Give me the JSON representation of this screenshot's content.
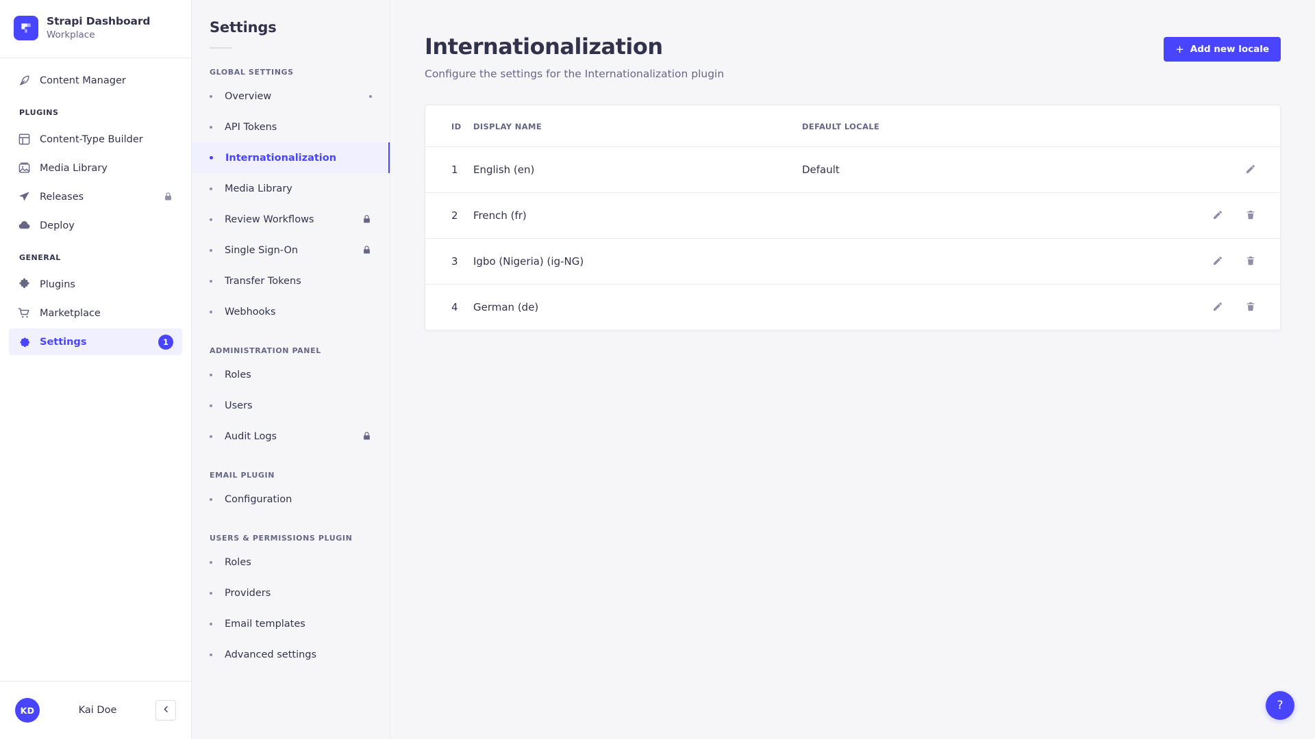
{
  "brand": {
    "title": "Strapi Dashboard",
    "subtitle": "Workplace",
    "logo_icon": "strapi-logo-icon",
    "accent_color": "#4945ff"
  },
  "mainnav": {
    "top_items": [
      {
        "label": "Content Manager",
        "icon": "feather-pen-icon",
        "locked": false,
        "active": false
      }
    ],
    "sections": [
      {
        "label": "PLUGINS",
        "items": [
          {
            "label": "Content-Type Builder",
            "icon": "layout-grid-icon",
            "locked": false,
            "active": false
          },
          {
            "label": "Media Library",
            "icon": "image-icon",
            "locked": false,
            "active": false
          },
          {
            "label": "Releases",
            "icon": "paper-plane-icon",
            "locked": true,
            "active": false
          },
          {
            "label": "Deploy",
            "icon": "cloud-icon",
            "locked": false,
            "active": false
          }
        ]
      },
      {
        "label": "GENERAL",
        "items": [
          {
            "label": "Plugins",
            "icon": "puzzle-piece-icon",
            "locked": false,
            "active": false
          },
          {
            "label": "Marketplace",
            "icon": "shopping-cart-icon",
            "locked": false,
            "active": false
          },
          {
            "label": "Settings",
            "icon": "gear-icon",
            "locked": false,
            "active": true,
            "badge": "1"
          }
        ]
      }
    ]
  },
  "user": {
    "initials": "KD",
    "name": "Kai Doe",
    "collapse_icon": "chevron-left-icon"
  },
  "subnav": {
    "title": "Settings",
    "sections": [
      {
        "label": "GLOBAL SETTINGS",
        "items": [
          {
            "label": "Overview",
            "active": false,
            "locked": false,
            "trailing_dot": true
          },
          {
            "label": "API Tokens",
            "active": false,
            "locked": false,
            "trailing_dot": false
          },
          {
            "label": "Internationalization",
            "active": true,
            "locked": false,
            "trailing_dot": false
          },
          {
            "label": "Media Library",
            "active": false,
            "locked": false,
            "trailing_dot": false
          },
          {
            "label": "Review Workflows",
            "active": false,
            "locked": true,
            "trailing_dot": false
          },
          {
            "label": "Single Sign-On",
            "active": false,
            "locked": true,
            "trailing_dot": false
          },
          {
            "label": "Transfer Tokens",
            "active": false,
            "locked": false,
            "trailing_dot": false
          },
          {
            "label": "Webhooks",
            "active": false,
            "locked": false,
            "trailing_dot": false
          }
        ]
      },
      {
        "label": "ADMINISTRATION PANEL",
        "items": [
          {
            "label": "Roles",
            "active": false,
            "locked": false,
            "trailing_dot": false
          },
          {
            "label": "Users",
            "active": false,
            "locked": false,
            "trailing_dot": false
          },
          {
            "label": "Audit Logs",
            "active": false,
            "locked": true,
            "trailing_dot": false
          }
        ]
      },
      {
        "label": "EMAIL PLUGIN",
        "items": [
          {
            "label": "Configuration",
            "active": false,
            "locked": false,
            "trailing_dot": false
          }
        ]
      },
      {
        "label": "USERS & PERMISSIONS PLUGIN",
        "items": [
          {
            "label": "Roles",
            "active": false,
            "locked": false,
            "trailing_dot": false
          },
          {
            "label": "Providers",
            "active": false,
            "locked": false,
            "trailing_dot": false
          },
          {
            "label": "Email templates",
            "active": false,
            "locked": false,
            "trailing_dot": false
          },
          {
            "label": "Advanced settings",
            "active": false,
            "locked": false,
            "trailing_dot": false
          }
        ]
      }
    ]
  },
  "page": {
    "title": "Internationalization",
    "subtitle": "Configure the settings for the Internationalization plugin",
    "add_button_label": "Add new locale",
    "add_button_icon": "plus-icon"
  },
  "table": {
    "columns": [
      "ID",
      "DISPLAY NAME",
      "DEFAULT LOCALE"
    ],
    "rows": [
      {
        "id": "1",
        "display_name": "English (en)",
        "default_locale": "Default",
        "can_edit": true,
        "can_delete": false
      },
      {
        "id": "2",
        "display_name": "French (fr)",
        "default_locale": "",
        "can_edit": true,
        "can_delete": true
      },
      {
        "id": "3",
        "display_name": "Igbo (Nigeria) (ig-NG)",
        "default_locale": "",
        "can_edit": true,
        "can_delete": true
      },
      {
        "id": "4",
        "display_name": "German (de)",
        "default_locale": "",
        "can_edit": true,
        "can_delete": true
      }
    ]
  },
  "help": {
    "label": "?",
    "icon": "question-mark-icon"
  }
}
